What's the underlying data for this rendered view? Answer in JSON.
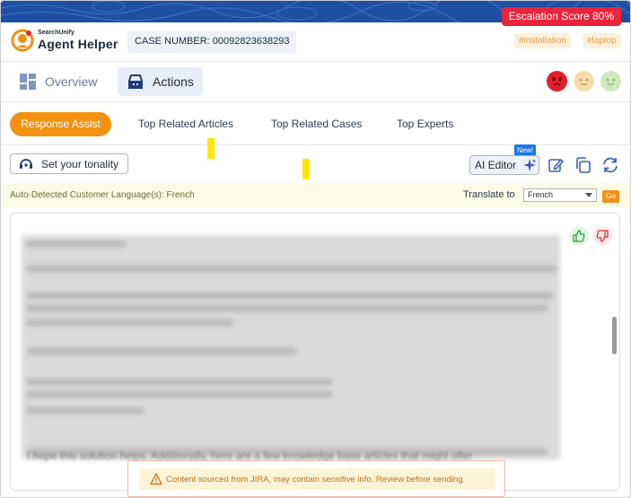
{
  "header": {
    "escalation_score": "Escalation Score 80%",
    "brand_small": "SearchUnify",
    "brand_name": "Agent Helper",
    "case_number": "CASE NUMBER: 00092823638293",
    "tags": [
      "#installation",
      "#laptop"
    ]
  },
  "nav": {
    "tabs": [
      {
        "label": "Overview",
        "icon": "grid-icon"
      },
      {
        "label": "Actions",
        "icon": "inbox-icon"
      }
    ],
    "active": "Actions",
    "sentiments": [
      "angry-face-icon",
      "neutral-face-icon",
      "happy-face-icon"
    ]
  },
  "subtabs": {
    "items": [
      "Response Assist",
      "Top Related Articles",
      "Top Related Cases",
      "Top Experts"
    ],
    "active": "Response Assist"
  },
  "toolbar": {
    "tonality_label": "Set your tonality",
    "ai_editor_label": "AI Editor",
    "new_badge": "New!",
    "icons": [
      "edit-icon",
      "copy-icon",
      "refresh-icon"
    ]
  },
  "language": {
    "detected": "Auto-Detected Customer Language(s): French",
    "translate_label": "Translate to",
    "selected": "French",
    "go_label": "Go"
  },
  "response": {
    "trailing_line": "I hope this solution helps. Additionally, here are a few knowledge base articles that might offer",
    "warning": "Content sourced from JIRA, may contain sensitive info. Review before sending."
  },
  "colors": {
    "accent_orange": "#f39110",
    "escalation_red": "#e8253b",
    "band_blue": "#1f4fa3",
    "highlight_yellow": "#ffe600"
  }
}
